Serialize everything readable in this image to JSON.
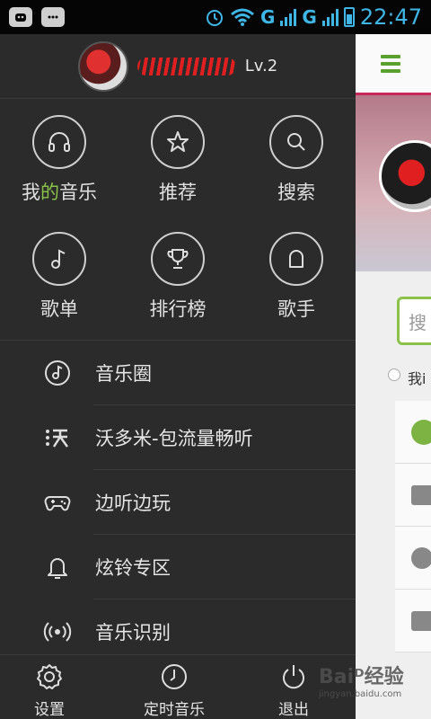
{
  "status_bar": {
    "time": "22:47",
    "network_1": "G",
    "sim_1": "1",
    "network_2": "G",
    "sim_2": "2"
  },
  "profile": {
    "level": "Lv.2"
  },
  "grid": [
    {
      "label_pre": "我",
      "label_accent": "的",
      "label_post": "音乐",
      "icon": "headphones-icon"
    },
    {
      "label": "推荐",
      "icon": "star-icon"
    },
    {
      "label": "搜索",
      "icon": "search-icon"
    },
    {
      "label": "歌单",
      "icon": "music-note-icon"
    },
    {
      "label": "排行榜",
      "icon": "trophy-icon"
    },
    {
      "label": "歌手",
      "icon": "singer-icon"
    }
  ],
  "menu": [
    {
      "label": "音乐圈",
      "icon": "disc-icon"
    },
    {
      "label": "沃多米-包流量畅听",
      "icon": "wo-icon"
    },
    {
      "label": "边听边玩",
      "icon": "gamepad-icon"
    },
    {
      "label": "炫铃专区",
      "icon": "bell-icon"
    },
    {
      "label": "音乐识别",
      "icon": "radar-icon"
    }
  ],
  "bottom_bar": [
    {
      "label": "设置",
      "icon": "gear-icon"
    },
    {
      "label": "定时音乐",
      "icon": "clock-icon"
    },
    {
      "label": "退出",
      "icon": "power-icon"
    }
  ],
  "content": {
    "search_placeholder": "搜",
    "mine_label": "我i"
  },
  "watermark": {
    "text": "Baiᴰ经验",
    "url": "jingyan.baidu.com"
  },
  "colors": {
    "accent_green": "#8bc34a",
    "drawer_bg": "#2b2b2b",
    "topbar_underline": "#c6285a",
    "status_blue": "#3fb6e6"
  }
}
